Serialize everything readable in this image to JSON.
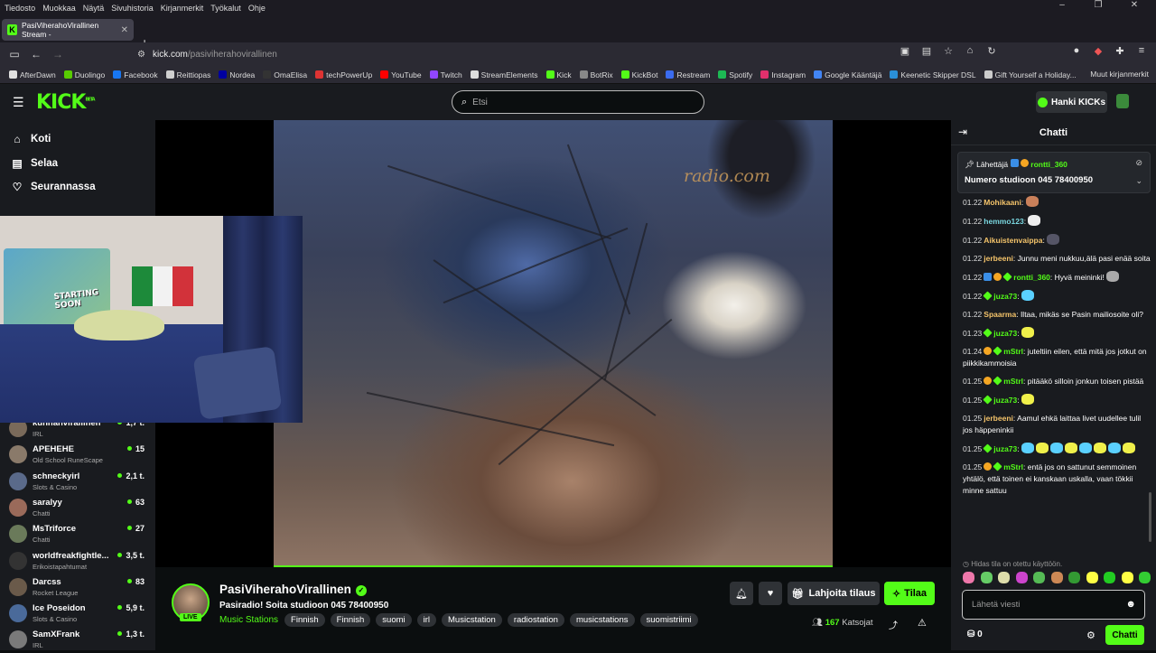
{
  "menubar": [
    "Tiedosto",
    "Muokkaa",
    "Näytä",
    "Sivuhistoria",
    "Kirjanmerkit",
    "Työkalut",
    "Ohje"
  ],
  "tab": {
    "title": "PasiViherahoVirallinen Stream -"
  },
  "url": {
    "host": "kick.com",
    "path": "/pasiviherahovirallinen"
  },
  "bookmarks": [
    {
      "label": "AfterDawn",
      "color": "#e0e0e0"
    },
    {
      "label": "Duolingo",
      "color": "#58cc02"
    },
    {
      "label": "Facebook",
      "color": "#1877f2"
    },
    {
      "label": "Reittiopas",
      "color": "#cfcfcf"
    },
    {
      "label": "Nordea",
      "color": "#0000a0"
    },
    {
      "label": "OmaElisa",
      "color": "#333"
    },
    {
      "label": "techPowerUp",
      "color": "#d33"
    },
    {
      "label": "YouTube",
      "color": "#ff0000"
    },
    {
      "label": "Twitch",
      "color": "#9146ff"
    },
    {
      "label": "StreamElements",
      "color": "#ddd"
    },
    {
      "label": "Kick",
      "color": "#53fc18"
    },
    {
      "label": "BotRix",
      "color": "#888"
    },
    {
      "label": "KickBot",
      "color": "#53fc18"
    },
    {
      "label": "Restream",
      "color": "#3b6cf0"
    },
    {
      "label": "Spotify",
      "color": "#1db954"
    },
    {
      "label": "Instagram",
      "color": "#e1306c"
    },
    {
      "label": "Google Kääntäjä",
      "color": "#4285f4"
    },
    {
      "label": "Keenetic Skipper DSL",
      "color": "#2a8fd8"
    },
    {
      "label": "Gift Yourself a Holiday...",
      "color": "#ccc"
    }
  ],
  "bookmarks_other": "Muut kirjanmerkit",
  "header": {
    "logo": "KICK",
    "logo_badge": "BETA",
    "search_placeholder": "Etsi",
    "kicks_button": "Hanki KICKs"
  },
  "sidebar": {
    "nav": [
      {
        "label": "Koti",
        "icon": "home-icon"
      },
      {
        "label": "Selaa",
        "icon": "browse-icon"
      },
      {
        "label": "Seurannassa",
        "icon": "heart-icon"
      }
    ],
    "channels": [
      {
        "name": "kunnanvirallinen",
        "category": "IRL",
        "viewers": "1,7 t.",
        "color": "#7a6a5a"
      },
      {
        "name": "APEHEHE",
        "category": "Old School RuneScape",
        "viewers": "15",
        "color": "#8a7a6a"
      },
      {
        "name": "schneckyirl",
        "category": "Slots & Casino",
        "viewers": "2,1 t.",
        "color": "#5a6a8a"
      },
      {
        "name": "saralyy",
        "category": "Chatti",
        "viewers": "63",
        "color": "#9a6a5a"
      },
      {
        "name": "MsTriforce",
        "category": "Chatti",
        "viewers": "27",
        "color": "#6a7a5a"
      },
      {
        "name": "worldfreakfightle...",
        "category": "Erikoistapahtumat",
        "viewers": "3,5 t.",
        "color": "#333"
      },
      {
        "name": "Darcss",
        "category": "Rocket League",
        "viewers": "83",
        "color": "#6a5a4a"
      },
      {
        "name": "Ice Poseidon",
        "category": "Slots & Casino",
        "viewers": "5,9 t.",
        "color": "#4a6a9a"
      },
      {
        "name": "SamXFrank",
        "category": "IRL",
        "viewers": "1,3 t.",
        "color": "#7a7a7a"
      }
    ]
  },
  "player": {
    "watermark": "radio.com",
    "webcam_sign": "STARTING SOON"
  },
  "channel": {
    "name": "PasiViherahoVirallinen",
    "live_label": "LIVE",
    "title": "Pasiradio! Soita studioon 045 78400950",
    "category": "Music Stations",
    "tags": [
      "Finnish",
      "Finnish",
      "suomi",
      "irl",
      "Musicstation",
      "radiostation",
      "musicstations",
      "suomistriimi"
    ],
    "gift_label": "Lahjoita tilaus",
    "subscribe_label": "Tilaa",
    "viewers": "167",
    "viewers_label": "Katsojat"
  },
  "chat": {
    "title": "Chatti",
    "pinned": {
      "role": "Lähettäjä",
      "user": "rontti_360",
      "message": "Numero studioon 045 78400950"
    },
    "messages": [
      {
        "time": "01.22",
        "user": "Mohikaani",
        "color": "#f5c46a",
        "badges": [],
        "text": "",
        "emotes": [
          "#c9805a"
        ]
      },
      {
        "time": "01.22",
        "user": "hemmo123",
        "color": "#7ad7e0",
        "badges": [],
        "text": "",
        "emotes": [
          "#eee"
        ]
      },
      {
        "time": "01.22",
        "user": "Aikuistenvaippa",
        "color": "#f5c46a",
        "badges": [],
        "text": "",
        "emotes": [
          "#556"
        ]
      },
      {
        "time": "01.22",
        "user": "jerbeeni",
        "color": "#f5c46a",
        "badges": [],
        "text": "Junnu meni nukkuu,älä pasi enää soita",
        "emotes": []
      },
      {
        "time": "01.22",
        "user": "rontti_360",
        "color": "#53fc18",
        "badges": [
          "b",
          "o",
          "g"
        ],
        "text": "Hyvä meininki! ",
        "emotes": [
          "#aaa"
        ]
      },
      {
        "time": "01.22",
        "user": "juza73",
        "color": "#53fc18",
        "badges": [
          "g"
        ],
        "text": "",
        "emotes": [
          "#5ad0ff"
        ]
      },
      {
        "time": "01.22",
        "user": "Spaarma",
        "color": "#f5c46a",
        "badges": [],
        "text": "Iltaa, mikäs se Pasin mailiosoite oli?",
        "emotes": []
      },
      {
        "time": "01.23",
        "user": "juza73",
        "color": "#53fc18",
        "badges": [
          "g"
        ],
        "text": "",
        "emotes": [
          "#f0f04a"
        ]
      },
      {
        "time": "01.24",
        "user": "mStrl",
        "color": "#53fc18",
        "badges": [
          "o",
          "g"
        ],
        "text": "juteltiin eilen, että mitä jos jotkut on piikkikammoisia",
        "emotes": []
      },
      {
        "time": "01.25",
        "user": "mStrl",
        "color": "#53fc18",
        "badges": [
          "o",
          "g"
        ],
        "text": "pitääkö silloin jonkun toisen pistää",
        "emotes": []
      },
      {
        "time": "01.25",
        "user": "juza73",
        "color": "#53fc18",
        "badges": [
          "g"
        ],
        "text": "",
        "emotes": [
          "#f0f04a"
        ]
      },
      {
        "time": "01.25",
        "user": "jerbeeni",
        "color": "#f5c46a",
        "badges": [],
        "text": "Aamul ehkä laittaa livet uudellee tulil jos häppeninkii",
        "emotes": []
      },
      {
        "time": "01.25",
        "user": "juza73",
        "color": "#53fc18",
        "badges": [
          "g"
        ],
        "text": "",
        "emotes": [
          "#5ad0ff",
          "#f0f04a",
          "#5ad0ff",
          "#f0f04a",
          "#5ad0ff",
          "#f0f04a",
          "#5ad0ff",
          "#f0f04a"
        ]
      },
      {
        "time": "01.25",
        "user": "mStrl",
        "color": "#53fc18",
        "badges": [
          "o",
          "g"
        ],
        "text": "entä jos on sattunut semmoinen yhtälö, että toinen ei kanskaan uskalla, vaan tökkii minne sattuu",
        "emotes": []
      }
    ],
    "slow_mode": "Hidas tila on otettu käyttöön.",
    "emote_bar": [
      "#e7a",
      "#6c6",
      "#dda",
      "#c4c",
      "#5b5",
      "#c85",
      "#393",
      "#ff4",
      "#2c2",
      "#ff4",
      "#3c3"
    ],
    "input_placeholder": "Lähetä viesti",
    "points": "0",
    "send_label": "Chatti"
  }
}
